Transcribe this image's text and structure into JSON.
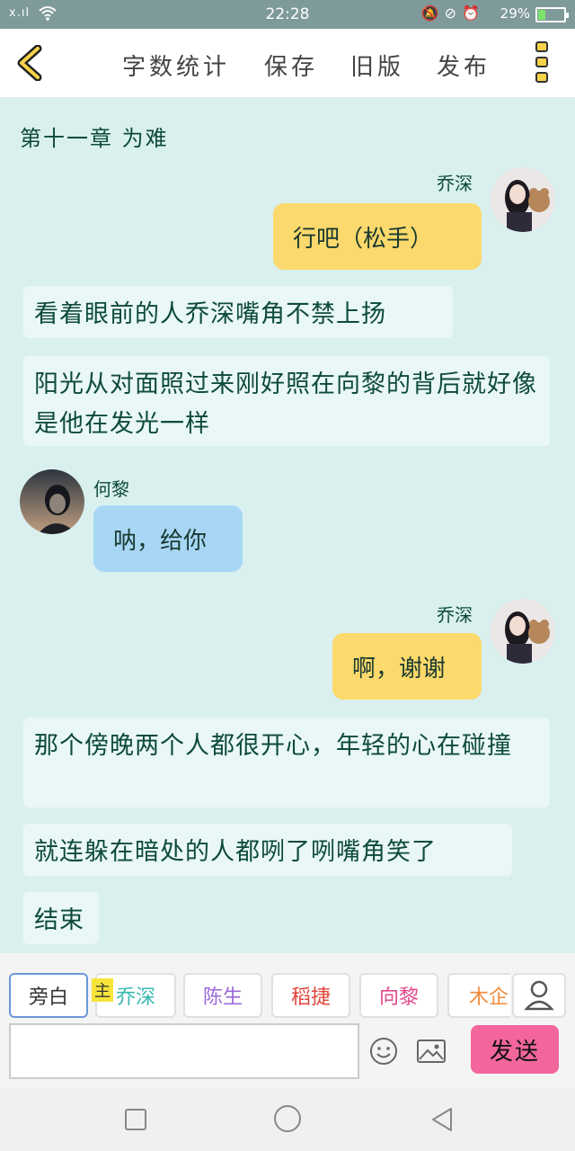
{
  "status_bar": {
    "signal": "x.ıl",
    "time": "22:28",
    "battery_percent": "29%",
    "battery_level": 0.29,
    "icons": [
      "mute-bell-icon",
      "lock-rotation-icon",
      "alarm-icon"
    ]
  },
  "toolbar": {
    "word_count": "字数统计",
    "save": "保存",
    "old_version": "旧版",
    "publish": "发布"
  },
  "chapter_title": "第十一章  为难",
  "messages": [
    {
      "type": "right",
      "speaker": "乔深",
      "text": "行吧（松手）"
    },
    {
      "type": "narration",
      "text": "看着眼前的人乔深嘴角不禁上扬"
    },
    {
      "type": "narration",
      "text": "阳光从对面照过来刚好照在向黎的背后就好像是他在发光一样"
    },
    {
      "type": "left",
      "speaker": "何黎",
      "text": "呐，给你"
    },
    {
      "type": "right",
      "speaker": "乔深",
      "text": "啊，谢谢"
    },
    {
      "type": "narration",
      "text": "那个傍晚两个人都很开心，年轻的心在碰撞"
    },
    {
      "type": "narration",
      "text": "就连躲在暗处的人都咧了咧嘴角笑了"
    },
    {
      "type": "narration",
      "text": "结束"
    }
  ],
  "characters": [
    {
      "label": "旁白",
      "color": "#333333"
    },
    {
      "label": "乔深",
      "color": "#38b8b0"
    },
    {
      "label": "陈生",
      "color": "#9a68d8"
    },
    {
      "label": "稻捷",
      "color": "#e0443a"
    },
    {
      "label": "向黎",
      "color": "#e2478a"
    },
    {
      "label": "木企",
      "color": "#f08a3a"
    }
  ],
  "main_badge": "主",
  "send_label": "发送"
}
